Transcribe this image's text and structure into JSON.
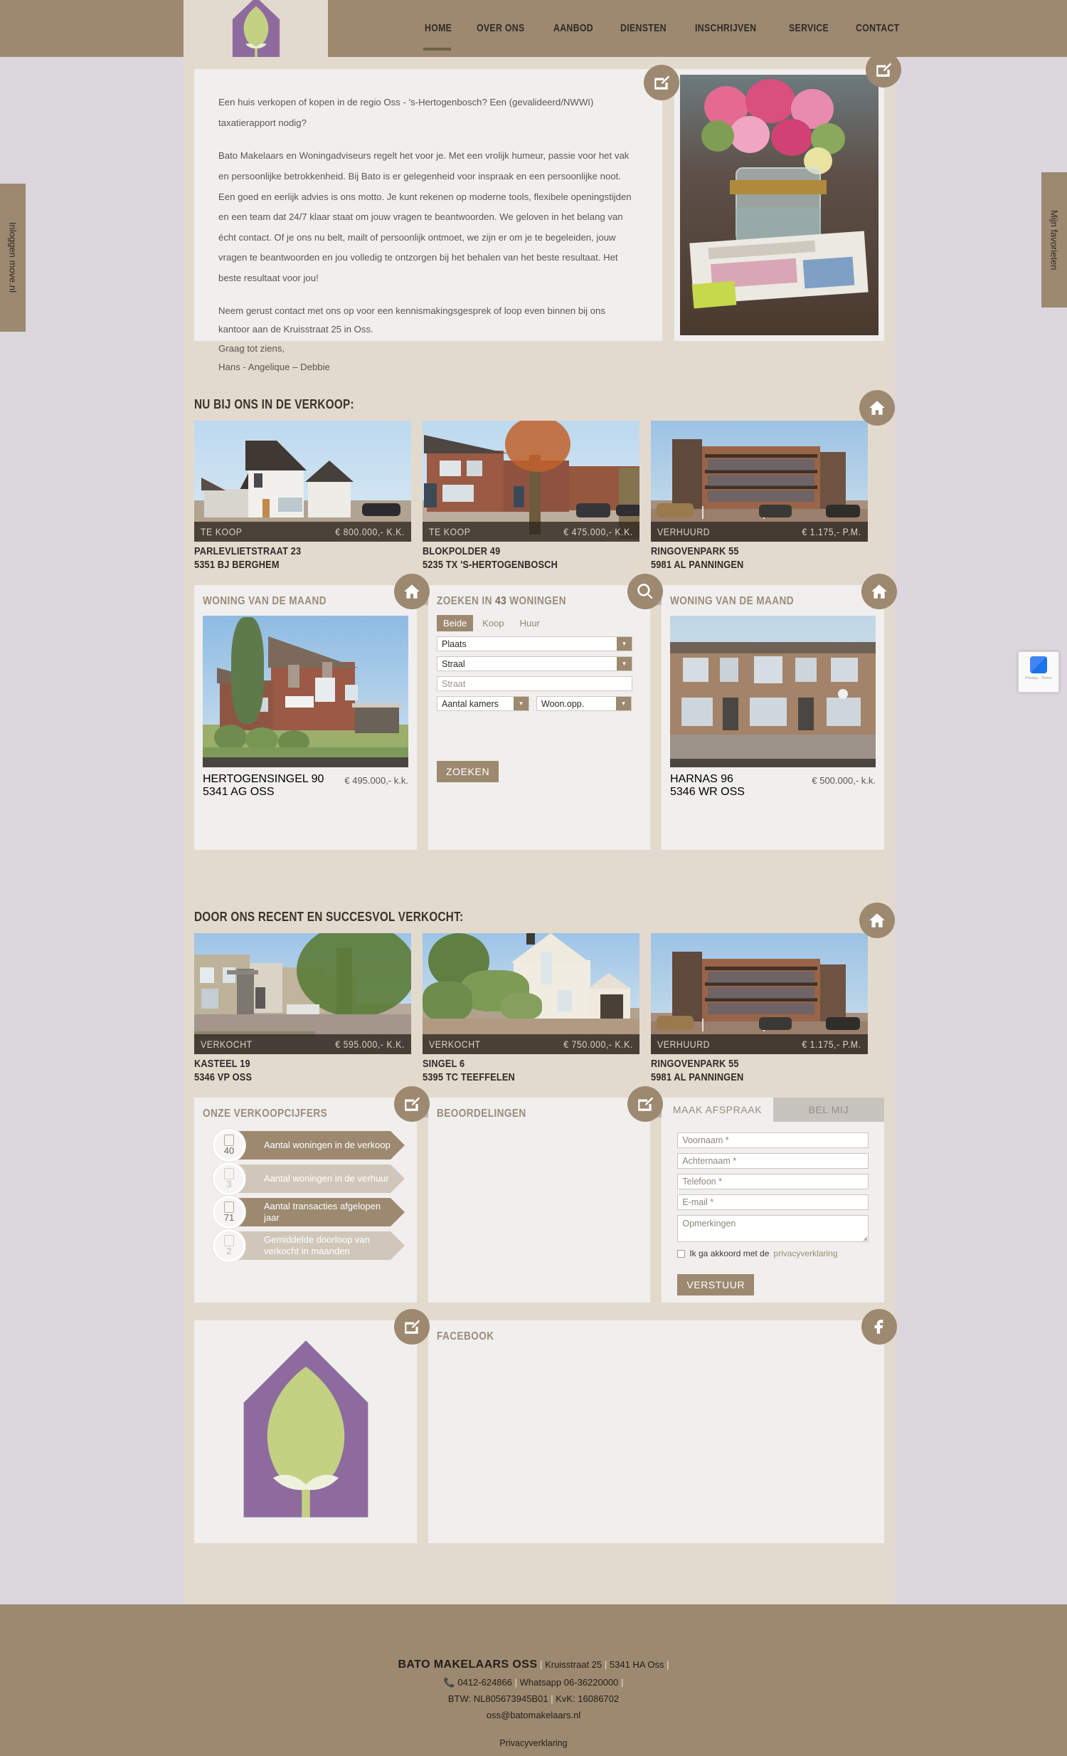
{
  "site": {
    "name": "Bato Makelaars Oss"
  },
  "header": {
    "logo_name": "bato-tree-logo",
    "nav": [
      {
        "label": "HOME",
        "active": true
      },
      {
        "label": "OVER ONS",
        "active": false
      },
      {
        "label": "AANBOD",
        "active": false
      },
      {
        "label": "DIENSTEN",
        "active": false
      },
      {
        "label": "INSCHRIJVEN",
        "active": false
      },
      {
        "label": "SERVICE",
        "active": false
      },
      {
        "label": "CONTACT",
        "active": false
      }
    ]
  },
  "side_tabs": {
    "left": "Inloggen move.nl",
    "right": "Mijn favorieten"
  },
  "intro": {
    "lead": "Een huis verkopen of kopen in de regio Oss - 's-Hertogenbosch? Een (gevalideerd/NWWI) taxatierapport nodig?",
    "body": "Bato Makelaars en Woningadviseurs regelt het voor je. Met een vrolijk humeur, passie voor het vak en persoonlijke betrokkenheid. Bij Bato is er gelegenheid voor inspraak en een persoonlijke noot. Een goed en eerlijk advies is ons motto. Je kunt rekenen op moderne tools, flexibele openingstijden en een team dat 24/7 klaar staat om jouw vragen te beantwoorden. We geloven in het belang van écht contact. Of je ons nu belt, mailt of persoonlijk ontmoet, we zijn er om je te begeleiden, jouw vragen te beantwoorden en jou volledig te ontzorgen bij het behalen van het beste resultaat. Het beste resultaat voor jou!",
    "line_contact": "Neem gerust contact met ons op voor een kennismakingsgesprek of loop even binnen bij ons kantoor aan de Kruisstraat 25 in Oss.",
    "line_bye": "Graag tot ziens,",
    "line_names": "Hans - Angelique – Debbie"
  },
  "sections": {
    "for_sale_title": "NU BIJ ONS IN DE VERKOOP:",
    "sold_title": "DOOR ONS RECENT EN SUCCESVOL VERKOCHT:",
    "month_title": "WONING VAN DE MAAND"
  },
  "for_sale": [
    {
      "status": "TE KOOP",
      "price": "€ 800.000,- K.K.",
      "street": "PARLEVLIETSTRAAT 23",
      "city": "5351 BJ BERGHEM",
      "img": "house-white-modern"
    },
    {
      "status": "TE KOOP",
      "price": "€ 475.000,- K.K.",
      "street": "BLOKPOLDER 49",
      "city": "5235 TX 'S-HERTOGENBOSCH",
      "img": "house-brick-terrace"
    },
    {
      "status": "VERHUURD",
      "price": "€ 1.175,- P.M.",
      "street": "RINGOVENPARK 55",
      "city": "5981 AL PANNINGEN",
      "img": "apartment-block"
    }
  ],
  "sold": [
    {
      "status": "VERKOCHT",
      "price": "€ 595.000,- K.K.",
      "street": "KASTEEL 19",
      "city": "5346 VP OSS",
      "img": "street-row-houses"
    },
    {
      "status": "VERKOCHT",
      "price": "€ 750.000,- K.K.",
      "street": "SINGEL 6",
      "city": "5395 TC TEEFFELEN",
      "img": "villa-white"
    },
    {
      "status": "VERHUURD",
      "price": "€ 1.175,- P.M.",
      "street": "RINGOVENPARK 55",
      "city": "5981 AL PANNINGEN",
      "img": "apartment-block"
    }
  ],
  "month_left": {
    "street": "HERTOGENSINGEL 90",
    "city": "5341 AG OSS",
    "price": "€ 495.000,- k.k."
  },
  "month_right": {
    "street": "HARNAS 96",
    "city": "5346 WR OSS",
    "price": "€ 500.000,- k.k."
  },
  "search": {
    "title_pre": "ZOEKEN IN ",
    "count": "43",
    "title_post": " WONINGEN",
    "tabs": [
      {
        "label": "Beide",
        "active": true
      },
      {
        "label": "Koop",
        "active": false
      },
      {
        "label": "Huur",
        "active": false
      }
    ],
    "place": "Plaats",
    "radius": "Straal",
    "street_placeholder": "Straat",
    "rooms": "Aantal kamers",
    "area": "Woon.opp.",
    "submit": "ZOEKEN"
  },
  "stats": {
    "title": "ONZE VERKOOPCIJFERS",
    "items": [
      {
        "value": "40",
        "label": "Aantal woningen in de verkoop",
        "highlight": true
      },
      {
        "value": "3",
        "label": "Aantal woningen in de verhuur",
        "highlight": false
      },
      {
        "value": "71",
        "label": "Aantal transacties afgelopen jaar",
        "highlight": true
      },
      {
        "value": "2",
        "label": "Gemiddelde doorloop van verkocht in maanden",
        "highlight": false
      }
    ]
  },
  "reviews": {
    "title": "BEOORDELINGEN"
  },
  "facebook": {
    "title": "FACEBOOK"
  },
  "contact": {
    "tab_appointment": "MAAK AFSPRAAK",
    "tab_callme": "BEL MIJ",
    "first_name": "Voornaam *",
    "last_name": "Achternaam *",
    "phone": "Telefoon *",
    "email": "E-mail *",
    "remarks": "Opmerkingen",
    "consent_pre": "Ik ga akkoord met de ",
    "consent_link": "privacyverklaring",
    "submit": "VERSTUUR"
  },
  "footer": {
    "brand": "BATO MAKELAARS OSS",
    "address": "Kruisstraat 25",
    "postal": "5341 HA Oss",
    "phone": "0412-624866",
    "whatsapp": "Whatsapp 06-36220000",
    "btw": "BTW: NL805673945B01",
    "kvk": "KvK: 16086702",
    "email": "oss@batomakelaars.nl",
    "privacy": "Privacyverklaring"
  },
  "recaptcha": {
    "text": "Privacy - Terms"
  },
  "colors": {
    "brown": "#9c8970",
    "beige": "#e3dace",
    "panel": "#f0efed",
    "purple": "#8e6b9e",
    "green": "#c3d182"
  }
}
